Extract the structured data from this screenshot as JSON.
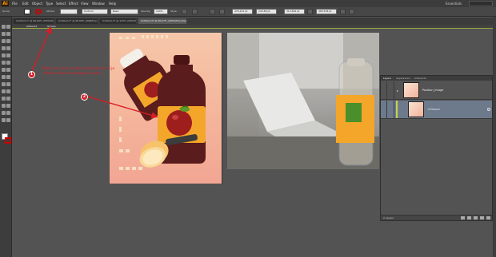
{
  "app": {
    "logo": "Ai"
  },
  "menubar": {
    "items": [
      "File",
      "Edit",
      "Object",
      "Type",
      "Select",
      "Effect",
      "View",
      "Window",
      "Help"
    ],
    "workspace": "Essentials"
  },
  "control_bar": {
    "selection_label": "Group",
    "stroke_label": "Stroke:",
    "uniform_label": "Uniform",
    "basic_label": "Basic",
    "opacity_label": "Opacity:",
    "opacity_value": "100%",
    "style_label": "Style:",
    "x_value": "476,421 pt",
    "y_value": "245,88 pt",
    "w_value": "312,862 pt",
    "h_value": "480,558 pt"
  },
  "tabs": [
    {
      "label": "Untitled-1* @ 66,66% (CMYK/Preview)",
      "active": false
    },
    {
      "label": "Untitled-2* @ 66,68% (RGB/Preview)",
      "active": false
    },
    {
      "label": "Untitled-3* @ 125% (CMYK/Preview)",
      "active": false
    },
    {
      "label": "Untitled-4* @ 66,67% (CMYK/Preview)",
      "active": true
    }
  ],
  "breadcrumb": {
    "layer": "Artboard",
    "group": "Groups"
  },
  "annotations": [
    {
      "number": "1",
      "text": "Ďalej, ak už to chcete skontrolovať, či je všetko správne zoskupené spolu"
    },
    {
      "number": "2",
      "text": ""
    }
  ],
  "layers_panel": {
    "tabs": [
      "Layers",
      "Appearance",
      "Artboards"
    ],
    "rows": [
      {
        "name": "Position_Image",
        "selected": false
      },
      {
        "name": "<Group>",
        "selected": true
      }
    ],
    "footer_label": "2 Layers"
  },
  "colors": {
    "accent_red": "#d91c24",
    "artboard_top": "#f6c7aa",
    "artboard_bottom": "#f2a693",
    "bottle_dark": "#5a1c1c",
    "juice_orange": "#f4a62a"
  }
}
